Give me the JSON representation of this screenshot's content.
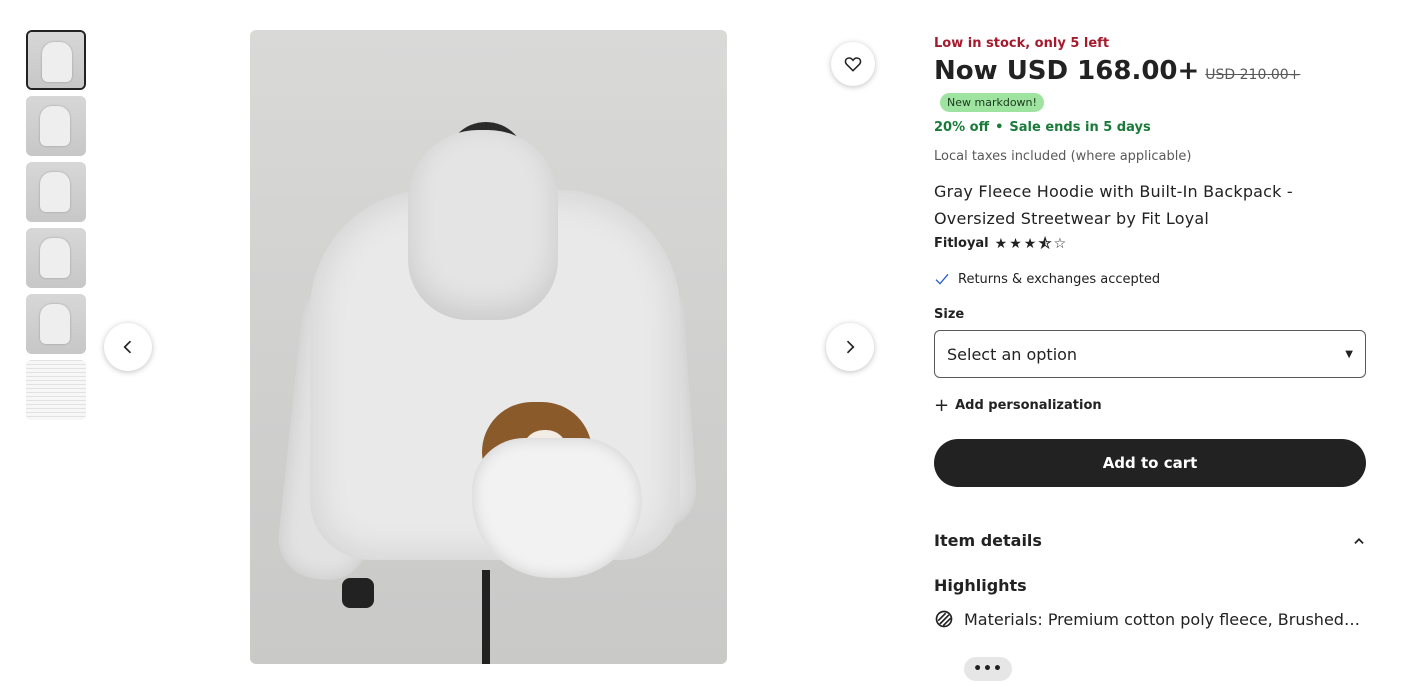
{
  "gallery": {
    "thumbnails": [
      {
        "icon": "hoodie-with-puppy-thumbnail",
        "active": true
      },
      {
        "icon": "hoodie-back-thumbnail",
        "active": false
      },
      {
        "icon": "hoodie-front-thumbnail",
        "active": false
      },
      {
        "icon": "hoodie-side-thumbnail",
        "active": false
      },
      {
        "icon": "hoodie-pouch-thumbnail",
        "active": false
      },
      {
        "icon": "size-chart-thumbnail",
        "active": false
      }
    ],
    "main_image_icon": "hoodie-with-puppy-photo",
    "prev_icon": "chevron-left-icon",
    "next_icon": "chevron-right-icon",
    "favorite_icon": "heart-icon"
  },
  "product": {
    "stock_note": "Low in stock, only 5 left",
    "price_now": "Now USD 168.00+",
    "price_old": "USD 210.00+",
    "markdown_badge": "New markdown!",
    "discount": "20% off",
    "separator": "•",
    "sale_ends": "Sale ends in 5 days",
    "taxes": "Local taxes included (where applicable)",
    "title": "Gray Fleece Hoodie with Built-In Backpack - Oversized Streetwear by Fit Loyal",
    "shop_name": "Fitloyal",
    "rating_stars": 3.5,
    "returns": "Returns & exchanges accepted",
    "size_label": "Size",
    "size_select_value": "Select an option",
    "personalization": "Add personalization",
    "add_to_cart": "Add to cart",
    "item_details": "Item details",
    "highlights": "Highlights",
    "materials": "Materials: Premium cotton poly fleece, Brushed s...",
    "more_label": "•••"
  },
  "colors": {
    "stock_red": "#a61a2e",
    "sale_green": "#1a7a3a",
    "badge_green": "#9ee4a0",
    "button_dark": "#222222"
  }
}
